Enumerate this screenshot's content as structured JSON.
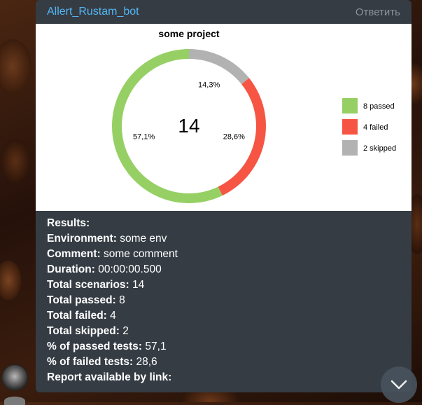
{
  "message": {
    "bot_name": "Allert_Rustam_bot",
    "reply_label": "Ответить"
  },
  "chart_data": {
    "type": "pie",
    "title": "some project",
    "center_label": "14",
    "slices": [
      {
        "label": "8 passed",
        "value": 8,
        "percent_label": "57,1%",
        "color": "#96d064"
      },
      {
        "label": "4 failed",
        "value": 4,
        "percent_label": "28,6%",
        "color": "#f65544"
      },
      {
        "label": "2 skipped",
        "value": 2,
        "percent_label": "14,3%",
        "color": "#b2b2b2"
      }
    ],
    "legend_position": "right"
  },
  "results": {
    "heading": "Results:",
    "rows": [
      {
        "key": "Environment:",
        "value": " some env"
      },
      {
        "key": "Comment:",
        "value": " some comment"
      },
      {
        "key": "Duration:",
        "value": " 00:00:00.500"
      },
      {
        "key": "Total scenarios:",
        "value": " 14"
      },
      {
        "key": "Total passed:",
        "value": " 8"
      },
      {
        "key": "Total failed:",
        "value": " 4"
      },
      {
        "key": "Total skipped:",
        "value": " 2"
      },
      {
        "key": "% of passed tests:",
        "value": " 57,1"
      },
      {
        "key": "% of failed tests:",
        "value": " 28,6"
      },
      {
        "key": "Report available by link:",
        "value": ""
      }
    ]
  },
  "icons": {
    "scroll_down": "chevron-down-icon",
    "avatar": "avatar"
  }
}
